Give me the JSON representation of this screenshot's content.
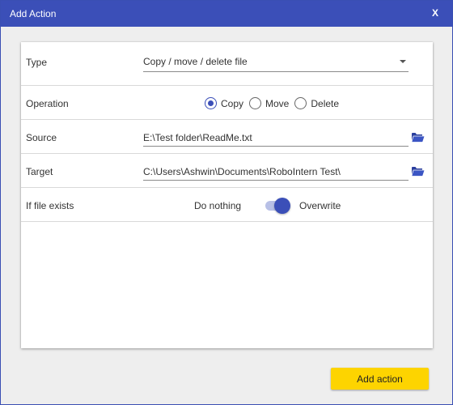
{
  "window": {
    "title": "Add Action",
    "close_label": "X"
  },
  "form": {
    "type": {
      "label": "Type",
      "value": "Copy / move / delete file"
    },
    "operation": {
      "label": "Operation",
      "options": [
        "Copy",
        "Move",
        "Delete"
      ],
      "selected": "Copy"
    },
    "source": {
      "label": "Source",
      "value": "E:\\Test folder\\ReadMe.txt",
      "icon": "folder-open-icon"
    },
    "target": {
      "label": "Target",
      "value": "C:\\Users\\Ashwin\\Documents\\RoboIntern Test\\",
      "icon": "folder-open-icon"
    },
    "if_exists": {
      "label": "If file exists",
      "off_label": "Do nothing",
      "on_label": "Overwrite",
      "state": "on"
    }
  },
  "footer": {
    "add_label": "Add action"
  },
  "colors": {
    "accent": "#3b4fb8",
    "button": "#fdd400"
  }
}
